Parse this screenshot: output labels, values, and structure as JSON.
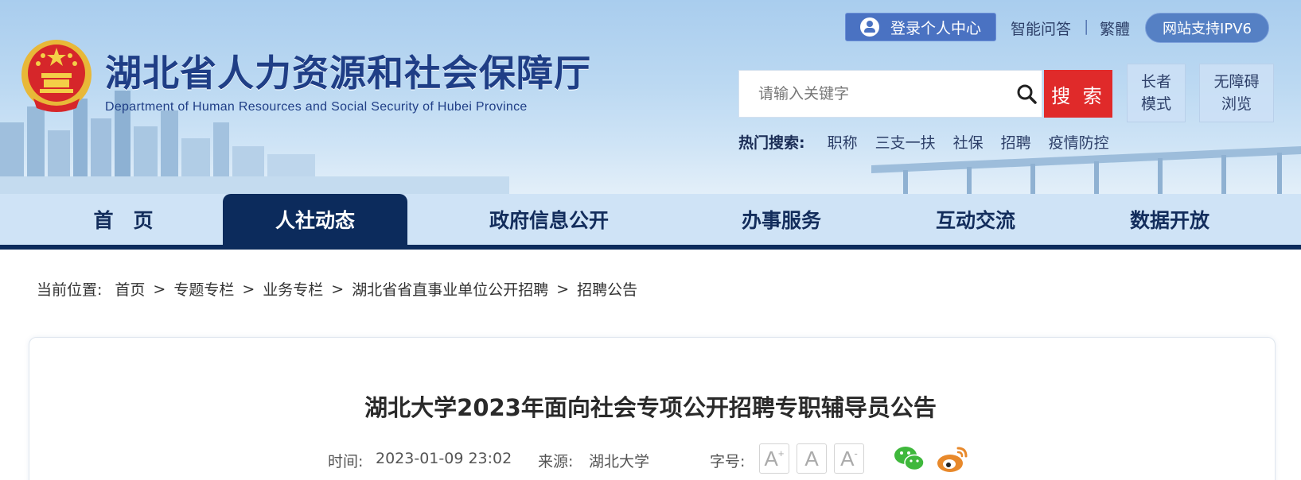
{
  "header": {
    "title": "湖北省人力资源和社会保障厅",
    "subtitle": "Department of Human Resources and Social Security of Hubei Province",
    "login_label": "登录个人中心",
    "qa_label": "智能问答",
    "separator": "|",
    "traditional_label": "繁體",
    "ipv6_label": "网站支持IPV6",
    "search_placeholder": "请输入关键字",
    "search_button": "搜 索",
    "elder_mode_line1": "长者",
    "elder_mode_line2": "模式",
    "accessible_line1": "无障碍",
    "accessible_line2": "浏览",
    "hot_label": "热门搜索:",
    "hot_items": [
      "职称",
      "三支一扶",
      "社保",
      "招聘",
      "疫情防控"
    ]
  },
  "nav": {
    "items": [
      "首　页",
      "人社动态",
      "政府信息公开",
      "办事服务",
      "互动交流",
      "数据开放"
    ],
    "active_index": 1
  },
  "breadcrumb": {
    "label": "当前位置:",
    "items": [
      "首页",
      "专题专栏",
      "业务专栏",
      "湖北省省直事业单位公开招聘",
      "招聘公告"
    ],
    "separator": ">"
  },
  "article": {
    "title": "湖北大学2023年面向社会专项公开招聘专职辅导员公告",
    "time_label": "时间:",
    "time_value": "2023-01-09 23:02",
    "source_label": "来源:",
    "source_value": "湖北大学",
    "font_size_label": "字号:",
    "font_buttons": [
      "A",
      "A",
      "A"
    ],
    "font_button_marks": [
      "+",
      "",
      "-"
    ],
    "share_icons": [
      "wechat-icon",
      "weibo-icon"
    ]
  },
  "colors": {
    "nav_active": "#0c2b5c",
    "search_button": "#e02a2a",
    "title_blue": "#1f3e86"
  }
}
